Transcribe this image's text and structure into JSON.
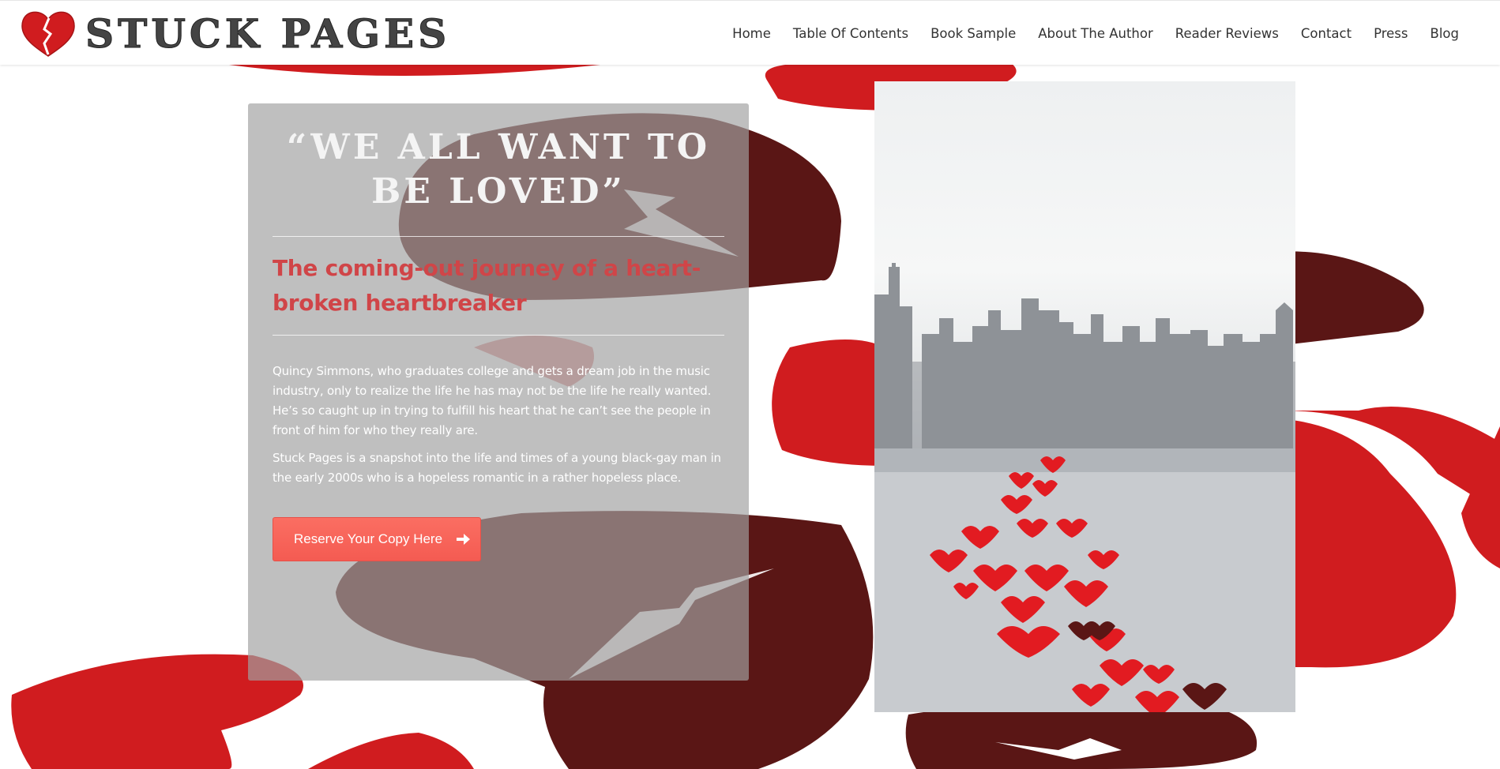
{
  "brand": {
    "name": "STUCK PAGES",
    "icon": "broken-heart-icon",
    "accent_color": "#d01c1f",
    "dark_red": "#5a1615"
  },
  "nav": {
    "items": [
      {
        "label": "Home"
      },
      {
        "label": "Table Of Contents"
      },
      {
        "label": "Book Sample"
      },
      {
        "label": "About The Author"
      },
      {
        "label": "Reader Reviews"
      },
      {
        "label": "Contact"
      },
      {
        "label": "Press"
      },
      {
        "label": "Blog"
      }
    ]
  },
  "hero": {
    "quote_line1": "“WE ALL WANT TO",
    "quote_line2": "BE LOVED”",
    "subtitle": "The coming-out journey of a heart-broken heartbreaker",
    "paragraph1": "Quincy Simmons, who graduates college and gets a dream job in the music industry, only to realize the life he has may not be the life he really wanted. He’s so caught up in trying to fulfill his heart that he can’t see the people in front of him for who they really are.",
    "paragraph2": "Stuck Pages is a snapshot into the life and times of a young black-gay man in the early 2000s who is a hopeless romantic in a rather hopeless place.",
    "button_label": "Reserve Your Copy Here",
    "button_icon": "arrow-right-icon",
    "button_color": "#f4665b",
    "subtitle_color": "#d04548"
  },
  "book_cover": {
    "description_icon": "city-skyline-hearts-image"
  }
}
